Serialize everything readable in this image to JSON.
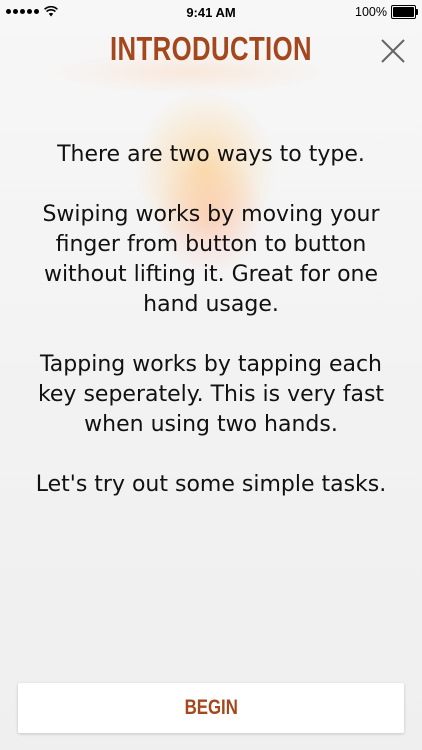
{
  "status_bar": {
    "time": "9:41 AM",
    "battery_percent_label": "100%",
    "battery_level": 1.0,
    "signal_bars": 5,
    "icons": [
      "signal-dots-icon",
      "wifi-icon",
      "battery-icon"
    ]
  },
  "header": {
    "title": "INTRODUCTION",
    "close_icon": "close-icon"
  },
  "intro": {
    "paragraphs": [
      "There are two ways to type.",
      "Swiping works by moving your finger from button to button without lifting it. Great for one hand usage.",
      "Tapping works by tapping each key seperately. This is very fast when using two hands.",
      "Let's try out some simple tasks."
    ]
  },
  "begin_button": {
    "label": "BEGIN"
  },
  "colors": {
    "accent": "#a4471c",
    "text": "#111111",
    "background": "#f3f3f3"
  }
}
